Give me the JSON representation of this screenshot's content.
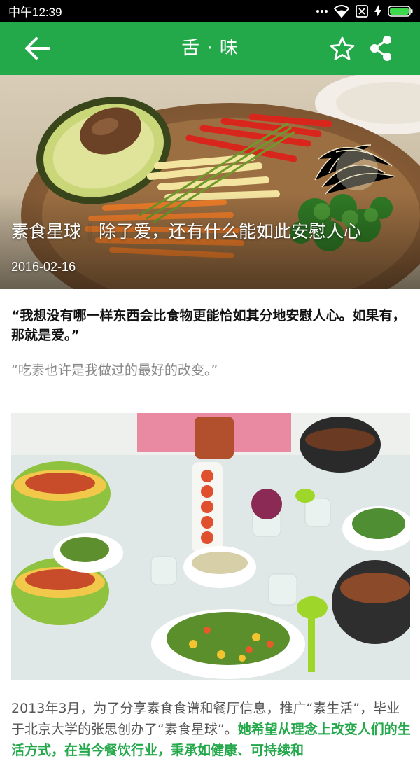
{
  "status_bar": {
    "time": "中午12:39"
  },
  "app_bar": {
    "title": "舌 · 味",
    "back_icon": "arrow-left-icon",
    "favorite_icon": "star-outline-icon",
    "share_icon": "share-icon"
  },
  "hero": {
    "title": "素食星球｜除了爱，还有什么能如此安慰人心",
    "date": "2016-02-16"
  },
  "article": {
    "quote_main": "“我想没有哪一样东西会比食物更能恰如其分地安慰人心。如果有，那就是爱。”",
    "quote_sub": "“吃素也许是我做过的最好的改变。”",
    "body_plain": "2013年3月，为了分享素食食谱和餐厅信息，推广“素生活”，毕业于北京大学的张思创办了“素食星球”。",
    "body_highlight": "她希望从理念上改变人们的生活方式，在当今餐饮行业，秉承如健康、可持续和"
  },
  "colors": {
    "primary": "#23a84a",
    "status_bar": "#000000"
  }
}
